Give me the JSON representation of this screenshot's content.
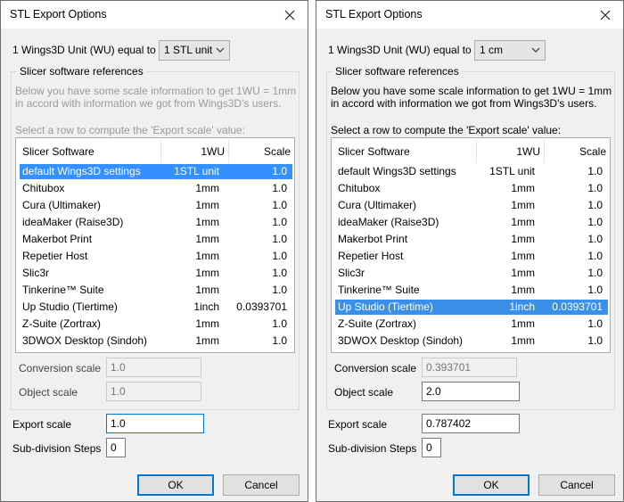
{
  "colors": {
    "selection_blue": "#3390ff",
    "focus_border": "#0078d7",
    "dialog_bg": "#f0f0f0"
  },
  "left_dialog": {
    "title": "STL Export Options",
    "close_icon": "close-icon",
    "unit_label": "1 Wings3D Unit (WU) equal to",
    "unit_select": "1 STL unit",
    "group_title": "Slicer software references",
    "info_text": "Below you have some scale information to get 1WU = 1mm in accord with information we got from Wings3D's users.",
    "select_prompt": "Select a row to compute the 'Export scale' value:",
    "columns": [
      "Slicer Software",
      "1WU",
      "Scale"
    ],
    "rows": [
      {
        "software": "default Wings3D settings",
        "wu": "1STL unit",
        "scale": "1.0"
      },
      {
        "software": "Chitubox",
        "wu": "1mm",
        "scale": "1.0"
      },
      {
        "software": "Cura (Ultimaker)",
        "wu": "1mm",
        "scale": "1.0"
      },
      {
        "software": "ideaMaker (Raise3D)",
        "wu": "1mm",
        "scale": "1.0"
      },
      {
        "software": "Makerbot Print",
        "wu": "1mm",
        "scale": "1.0"
      },
      {
        "software": "Repetier Host",
        "wu": "1mm",
        "scale": "1.0"
      },
      {
        "software": "Slic3r",
        "wu": "1mm",
        "scale": "1.0"
      },
      {
        "software": "Tinkerine™ Suite",
        "wu": "1mm",
        "scale": "1.0"
      },
      {
        "software": "Up Studio (Tiertime)",
        "wu": "1inch",
        "scale": "0.0393701"
      },
      {
        "software": "Z-Suite (Zortrax)",
        "wu": "1mm",
        "scale": "1.0"
      },
      {
        "software": "3DWOX Desktop (Sindoh)",
        "wu": "1mm",
        "scale": "1.0"
      }
    ],
    "selected_row": 0,
    "conversion_scale_label": "Conversion scale",
    "conversion_scale_value": "1.0",
    "object_scale_label": "Object scale",
    "object_scale_value": "1.0",
    "export_scale_label": "Export scale",
    "export_scale_value": "1.0",
    "subdivision_label": "Sub-division Steps",
    "subdivision_value": "0",
    "ok_label": "OK",
    "cancel_label": "Cancel"
  },
  "right_dialog": {
    "title": "STL Export Options",
    "close_icon": "close-icon",
    "unit_label": "1 Wings3D Unit (WU) equal to",
    "unit_select": "1 cm",
    "group_title": "Slicer software references",
    "info_text": "Below you have some scale information to get 1WU = 1mm in accord with information we got from Wings3D's users.",
    "select_prompt": "Select a row to compute the 'Export scale' value:",
    "columns": [
      "Slicer Software",
      "1WU",
      "Scale"
    ],
    "rows": [
      {
        "software": "default Wings3D settings",
        "wu": "1STL unit",
        "scale": "1.0"
      },
      {
        "software": "Chitubox",
        "wu": "1mm",
        "scale": "1.0"
      },
      {
        "software": "Cura (Ultimaker)",
        "wu": "1mm",
        "scale": "1.0"
      },
      {
        "software": "ideaMaker (Raise3D)",
        "wu": "1mm",
        "scale": "1.0"
      },
      {
        "software": "Makerbot Print",
        "wu": "1mm",
        "scale": "1.0"
      },
      {
        "software": "Repetier Host",
        "wu": "1mm",
        "scale": "1.0"
      },
      {
        "software": "Slic3r",
        "wu": "1mm",
        "scale": "1.0"
      },
      {
        "software": "Tinkerine™ Suite",
        "wu": "1mm",
        "scale": "1.0"
      },
      {
        "software": "Up Studio (Tiertime)",
        "wu": "1inch",
        "scale": "0.0393701"
      },
      {
        "software": "Z-Suite (Zortrax)",
        "wu": "1mm",
        "scale": "1.0"
      },
      {
        "software": "3DWOX Desktop (Sindoh)",
        "wu": "1mm",
        "scale": "1.0"
      }
    ],
    "selected_row": 8,
    "conversion_scale_label": "Conversion scale",
    "conversion_scale_value": "0.393701",
    "object_scale_label": "Object scale",
    "object_scale_value": "2.0",
    "export_scale_label": "Export scale",
    "export_scale_value": "0.787402",
    "subdivision_label": "Sub-division Steps",
    "subdivision_value": "0",
    "ok_label": "OK",
    "cancel_label": "Cancel"
  }
}
